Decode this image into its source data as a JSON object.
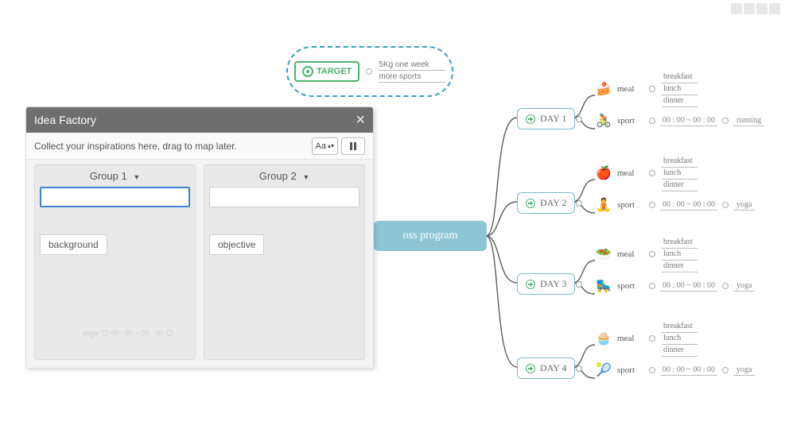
{
  "top_controls": {
    "count": 4
  },
  "idea_factory": {
    "title": "Idea Factory",
    "hint": "Collect your inspirations here, drag to map later.",
    "font_button": "Aa",
    "groups": [
      {
        "name": "Group 1",
        "chip": "background"
      },
      {
        "name": "Group 2",
        "chip": "objective"
      }
    ],
    "ghost_label": "yoga",
    "ghost_time": "00 : 00 ~ 00 : 00"
  },
  "target": {
    "badge_label": "TARGET",
    "lines": [
      "5Kg one week",
      "more sports"
    ]
  },
  "center_label": "oss program",
  "meals": [
    "breakfast",
    "lunch",
    "dinner"
  ],
  "time_format": "00 : 00 ~ 00 : 00",
  "meal_label": "meal",
  "sport_label": "sport",
  "days": [
    {
      "label": "DAY 1",
      "meal_icon": "🍰",
      "sport_icon": "🚴",
      "sport_name": "running"
    },
    {
      "label": "DAY 2",
      "meal_icon": "🍎",
      "sport_icon": "🧘",
      "sport_name": "yoga"
    },
    {
      "label": "DAY 3",
      "meal_icon": "🥗",
      "sport_icon": "🛼",
      "sport_name": "yoga"
    },
    {
      "label": "DAY 4",
      "meal_icon": "🧁",
      "sport_icon": "🎾",
      "sport_name": "yoga"
    }
  ]
}
